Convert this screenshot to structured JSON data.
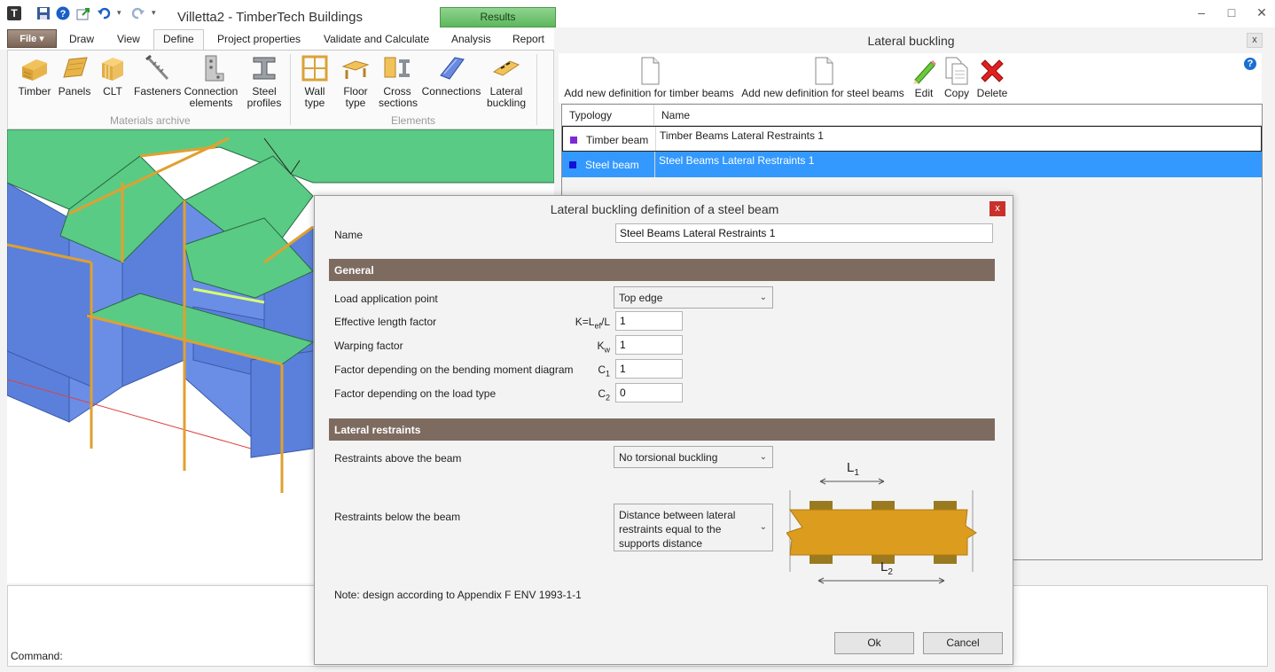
{
  "app": {
    "title": "Villetta2 - TimberTech Buildings",
    "results_tab": "Results",
    "window_controls": {
      "minimize": "–",
      "maximize": "□",
      "close": "✕"
    }
  },
  "ribbon": {
    "file_label": "File ▾",
    "tabs": [
      "Draw",
      "View",
      "Define",
      "Project properties",
      "Validate and Calculate",
      "Analysis",
      "Report"
    ],
    "active_tab": "Define",
    "groups": {
      "materials": {
        "label": "Materials archive",
        "buttons": [
          {
            "line1": "Timber",
            "line2": "",
            "icon": "timber-icon"
          },
          {
            "line1": "Panels",
            "line2": "",
            "icon": "panels-icon"
          },
          {
            "line1": "CLT",
            "line2": "",
            "icon": "clt-icon"
          },
          {
            "line1": "Fasteners",
            "line2": "",
            "icon": "fasteners-icon"
          },
          {
            "line1": "Connection",
            "line2": "elements",
            "icon": "connection-elements-icon"
          },
          {
            "line1": "Steel",
            "line2": "profiles",
            "icon": "steel-profiles-icon"
          }
        ]
      },
      "elements": {
        "label": "Elements",
        "buttons": [
          {
            "line1": "Wall",
            "line2": "type",
            "icon": "wall-type-icon"
          },
          {
            "line1": "Floor",
            "line2": "type",
            "icon": "floor-type-icon"
          },
          {
            "line1": "Cross",
            "line2": "sections",
            "icon": "cross-sections-icon"
          },
          {
            "line1": "Connections",
            "line2": "",
            "icon": "connections-icon"
          },
          {
            "line1": "Lateral",
            "line2": "buckling",
            "icon": "lateral-buckling-icon"
          }
        ]
      }
    }
  },
  "command": {
    "label": "Command:"
  },
  "lateral_buckling": {
    "title": "Lateral buckling",
    "close": "x",
    "help": "?",
    "toolbar": {
      "add_timber": "Add new definition for timber beams",
      "add_steel": "Add new definition for steel beams",
      "edit": "Edit",
      "copy": "Copy",
      "delete": "Delete"
    },
    "table": {
      "columns": [
        "Typology",
        "Name"
      ],
      "rows": [
        {
          "typology": "Timber beam",
          "name": "Timber Beams Lateral Restraints 1",
          "color": "#7d2ad6"
        },
        {
          "typology": "Steel beam",
          "name": "Steel Beams Lateral Restraints 1",
          "color": "#1010d8"
        }
      ],
      "selected_row": 1
    }
  },
  "dialog": {
    "title": "Lateral buckling definition of a steel beam",
    "close": "x",
    "name_label": "Name",
    "name_value": "Steel Beams Lateral Restraints 1",
    "general": {
      "header": "General",
      "load_point_label": "Load application point",
      "load_point_value": "Top edge",
      "effective_length_label": "Effective length factor",
      "effective_length_symbol": "K=Lef/L",
      "effective_length_value": "1",
      "warping_label": "Warping factor",
      "warping_symbol": "Kw",
      "warping_value": "1",
      "c1_label": "Factor depending on the bending moment diagram",
      "c1_symbol": "C1",
      "c1_value": "1",
      "c2_label": "Factor depending on the load type",
      "c2_symbol": "C2",
      "c2_value": "0"
    },
    "restraints": {
      "header": "Lateral restraints",
      "above_label": "Restraints above the beam",
      "above_value": "No torsional buckling",
      "below_label": "Restraints below the beam",
      "below_value": "Distance between lateral restraints equal to the supports distance",
      "diagram": {
        "top_label": "L1",
        "bottom_label": "L2"
      }
    },
    "note": "Note: design according to Appendix F ENV 1993-1-1",
    "ok": "Ok",
    "cancel": "Cancel"
  }
}
